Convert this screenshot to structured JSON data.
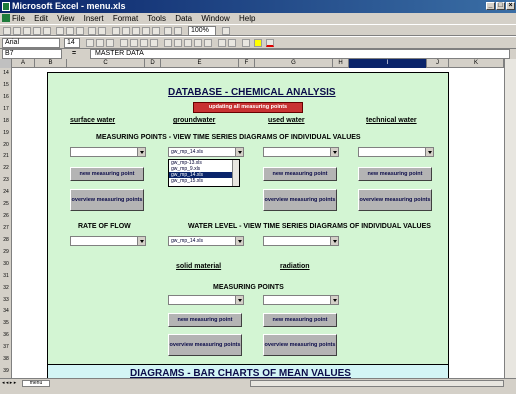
{
  "window": {
    "title": "Microsoft Excel - menu.xls"
  },
  "menu": [
    "File",
    "Edit",
    "View",
    "Insert",
    "Format",
    "Tools",
    "Data",
    "Window",
    "Help"
  ],
  "toolbar": {
    "font": "Arial",
    "size": "14",
    "zoom": "100%"
  },
  "formula_bar": {
    "cell": "B7",
    "fx": "=",
    "value": "MASTER DATA"
  },
  "columns": [
    "A",
    "B",
    "C",
    "D",
    "E",
    "F",
    "G",
    "H",
    "I",
    "J",
    "K"
  ],
  "rows": [
    "14",
    "15",
    "16",
    "17",
    "18",
    "19",
    "20",
    "21",
    "22",
    "23",
    "24",
    "25",
    "26",
    "27",
    "28",
    "29",
    "30",
    "31",
    "32",
    "33",
    "34",
    "35",
    "36",
    "37",
    "38",
    "39"
  ],
  "sheet": {
    "title": "DATABASE - CHEMICAL ANALYSIS",
    "update_label": "updating all measuring points",
    "water_types": [
      "surface water",
      "groundwater",
      "used water",
      "technical water"
    ],
    "ts_header": "MEASURING POINTS - VIEW TIME SERIES DIAGRAMS OF INDIVIDUAL VALUES",
    "selected_point": "gw_mp_14.xls",
    "list_items": [
      "gw_mp-13.xls",
      "gw_mp_9.xls",
      "gw_mp_14.xls",
      "gw_mp_15.xls"
    ],
    "new_point_label": "new measuring point",
    "overview_label": "overview measuring points",
    "rate_of_flow": "RATE OF FLOW",
    "water_level_header": "WATER LEVEL - VIEW TIME SERIES DIAGRAMS OF INDIVIDUAL VALUES",
    "water_level_value": "gw_mp_14.xls",
    "solid_material": "solid material",
    "radiation": "radiation",
    "measuring_points": "MEASURING POINTS",
    "bar_charts": "DIAGRAMS - BAR CHARTS OF MEAN VALUES"
  },
  "tabs": {
    "active": "menu"
  }
}
